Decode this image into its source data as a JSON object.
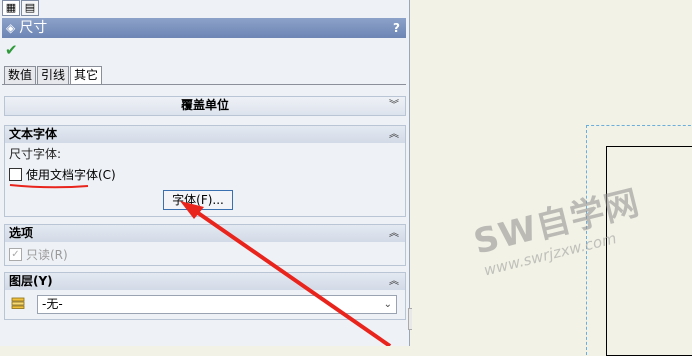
{
  "panel": {
    "title": "尺寸",
    "help": "?",
    "tabs": [
      "数值",
      "引线",
      "其它"
    ],
    "active_tab": "其它"
  },
  "groups": {
    "override_units": {
      "title": "覆盖单位",
      "chevron": "»"
    },
    "text_font": {
      "title": "文本字体",
      "dim_font_label": "尺寸字体:",
      "use_doc_font": "使用文档字体(C)",
      "use_doc_font_checked": false,
      "font_button": "字体(F)..."
    },
    "options": {
      "title": "选项",
      "readonly": "只读(R)",
      "readonly_checked": true
    },
    "layer": {
      "title": "图层(Y)",
      "value": "-无-"
    }
  },
  "watermark": {
    "main": "SW自学网",
    "sub": "www.swrjzxw.com"
  },
  "colors": {
    "title_bar": "#7690c0",
    "annotation": "#e8241c",
    "ok_check": "#2e9a3a"
  }
}
